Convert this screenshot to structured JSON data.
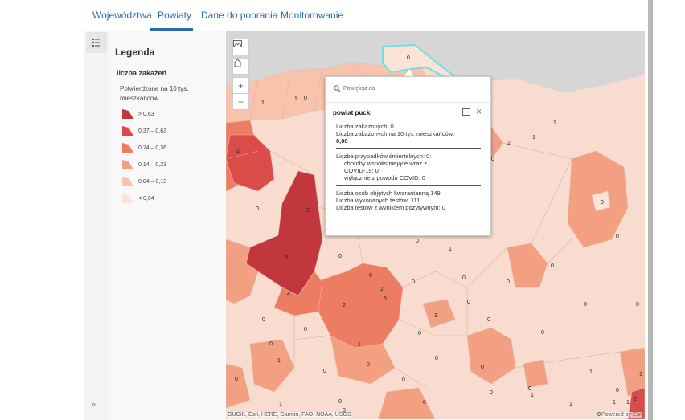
{
  "tabs": [
    {
      "label": "Województwa"
    },
    {
      "label": "Powiaty"
    },
    {
      "label": "Dane do pobrania"
    },
    {
      "label": "Monitorowanie"
    }
  ],
  "legend": {
    "title": "Legenda",
    "layer_title": "liczba zakażeń",
    "field_title": "Potwierdzone na 10 tys. mieszkańców",
    "classes": [
      {
        "label": "> 0,63",
        "color": "#c2363d"
      },
      {
        "label": "0,37 – 0,63",
        "color": "#d94c4a"
      },
      {
        "label": "0,24 – 0,36",
        "color": "#ec7d62"
      },
      {
        "label": "0,14 – 0,23",
        "color": "#f39f82"
      },
      {
        "label": "0,04 – 0,13",
        "color": "#f8c3ad"
      },
      {
        "label": "< 0,04",
        "color": "#fbe3d8"
      }
    ]
  },
  "map": {
    "colors": {
      "sea": "#d6d6d6",
      "land": "#f8dcd0",
      "selected_outline": "#6fe0e0"
    },
    "attribution": "GUGiK, Esri, HERE, Garmin, FAO, NOAA, USGS",
    "powered_by": "Powered by Esri",
    "labels": [
      "0",
      "1",
      "0",
      "1",
      "1",
      "2",
      "2",
      "1",
      "0",
      "3",
      "3",
      "0",
      "0",
      "1",
      "0",
      "0",
      "0",
      "0",
      "0",
      "0",
      "0",
      "0",
      "0",
      "0",
      "0",
      "0",
      "2",
      "4",
      "5",
      "2",
      "0",
      "3",
      "0",
      "0",
      "0",
      "1",
      "0",
      "1",
      "0",
      "0",
      "0",
      "1",
      "0",
      "0",
      "0",
      "0",
      "1",
      "0",
      "0",
      "0",
      "1",
      "0",
      "1",
      "1",
      "0",
      "1",
      "1",
      "2",
      "0"
    ]
  },
  "popup": {
    "zoom_label": "Powiększ do",
    "title": "powiat pucki",
    "cases_line": "Liczba zakażonych: 0",
    "cases_per_10k_label": "Liczba zakażonych na 10 tys. mieszkańców:",
    "cases_per_10k_value": "0,00",
    "deaths_line": "Liczba przypadków śmiertelnych: 0:",
    "comorbid_label": "choroby współistniejące wraz z",
    "comorbid_line": "COVID-19: 0",
    "covid_only_line": "wyłącznie z powodu COVID: 0",
    "quarantine_line": "Liczba osób objętych kwarantanną 149",
    "tests_line": "Liczba wykonanych testów: 111",
    "positive_line": "Liczba testów z wynikiem pozytywnym: 0"
  }
}
